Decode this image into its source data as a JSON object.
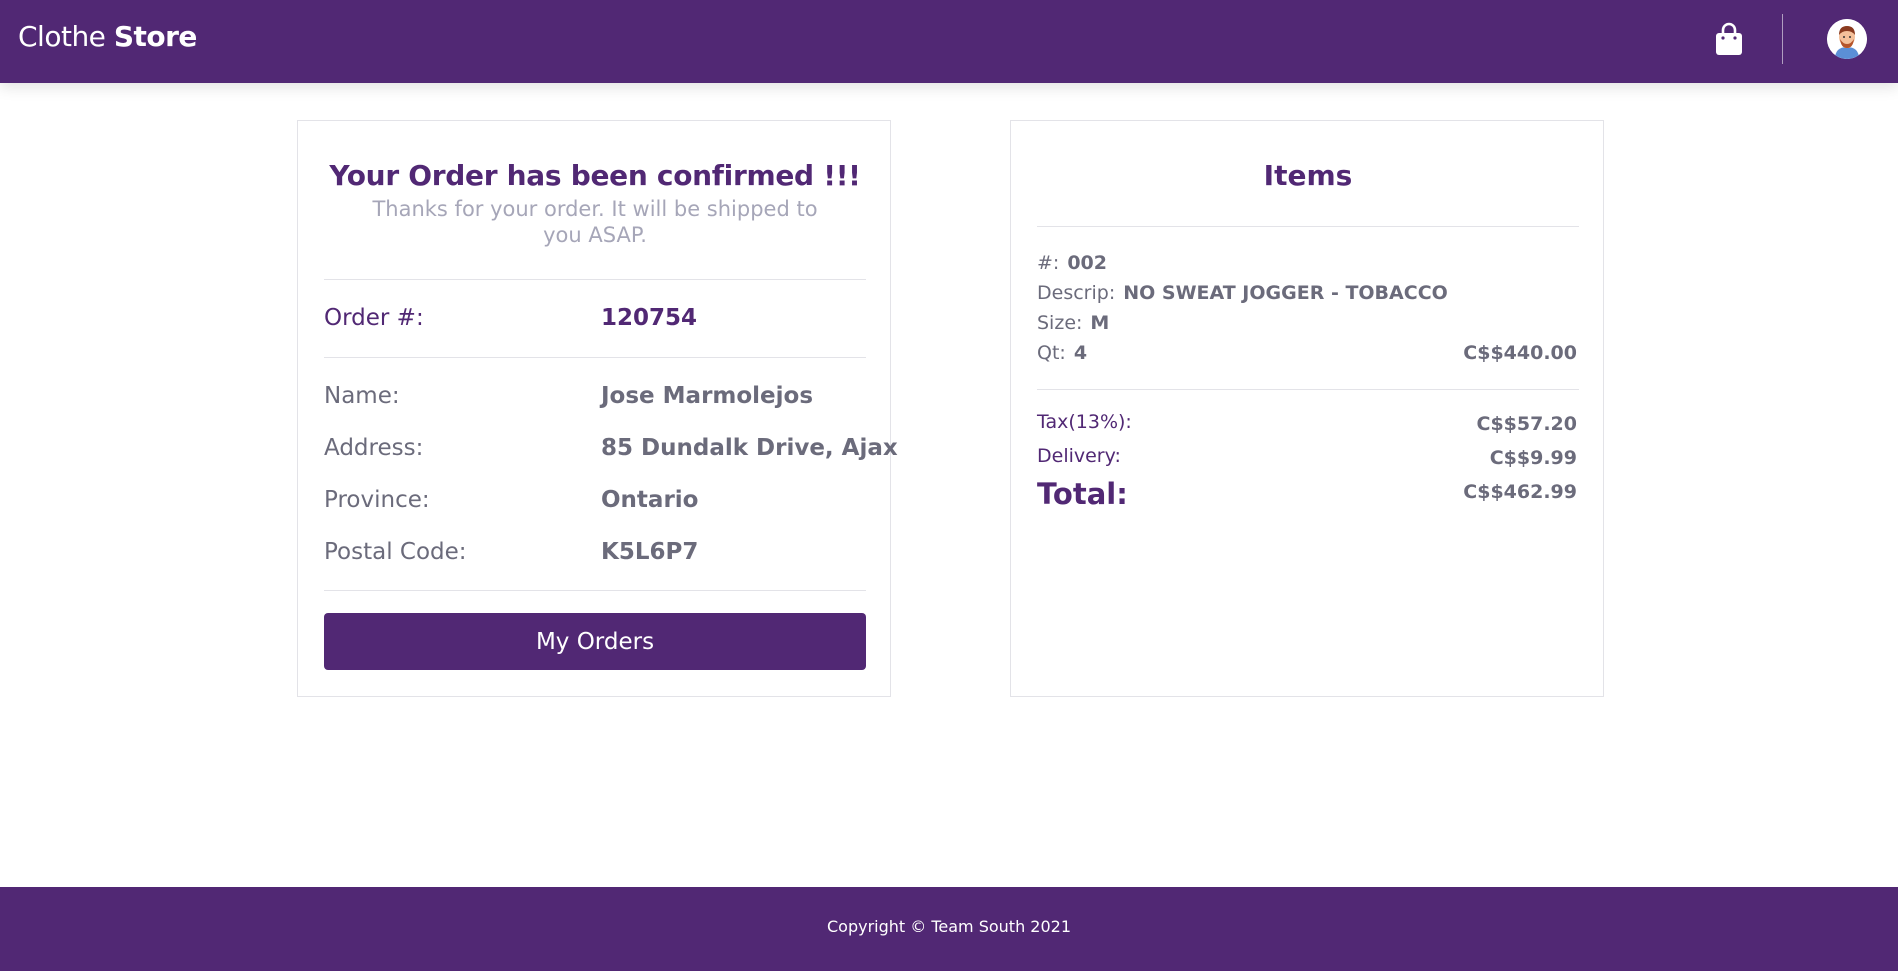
{
  "header": {
    "brand_regular": "Clothe",
    "brand_bold": "Store",
    "bag_icon": "shopping-bag-icon",
    "avatar_icon": "user-avatar-icon"
  },
  "confirmation": {
    "title": "Your Order has been confirmed !!!",
    "subtitle": "Thanks for your order. It will be shipped to you ASAP.",
    "order_label": "Order #:",
    "order_value": "120754",
    "name_label": "Name:",
    "name_value": "Jose Marmolejos",
    "address_label": "Address:",
    "address_value": "85 Dundalk Drive, Ajax",
    "province_label": "Province:",
    "province_value": "Ontario",
    "postal_label": "Postal Code:",
    "postal_value": "K5L6P7",
    "button_label": "My Orders"
  },
  "items": {
    "title": "Items",
    "list": [
      {
        "num_label": "#:",
        "num": "002",
        "desc_label": "Descrip:",
        "desc": "NO SWEAT JOGGER - TOBACCO",
        "size_label": "Size:",
        "size": "M",
        "qty_label": "Qt:",
        "qty": "4",
        "price": "C$$440.00"
      }
    ],
    "tax_label": "Tax(13%):",
    "tax_value": "C$$57.20",
    "delivery_label": "Delivery:",
    "delivery_value": "C$$9.99",
    "total_label": "Total:",
    "total_value": "C$$462.99"
  },
  "footer": {
    "copyright": "Copyright © Team South 2021"
  },
  "colors": {
    "primary": "#512874",
    "muted_text": "#6b6b7b",
    "subtitle_text": "#a6a6b8"
  }
}
